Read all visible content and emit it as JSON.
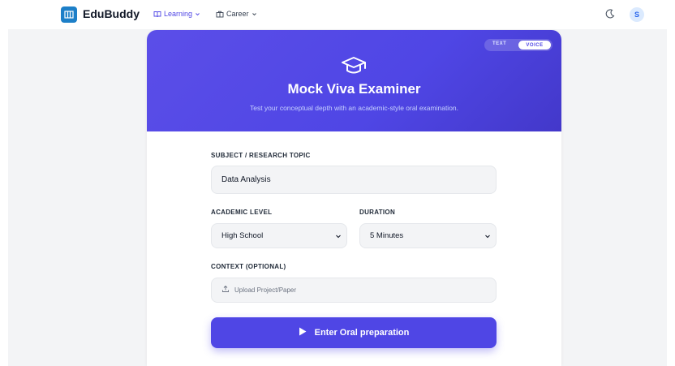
{
  "nav": {
    "brand": "EduBuddy",
    "learning": "Learning",
    "career": "Career",
    "avatar_initial": "S"
  },
  "hero": {
    "toggle_text": "TEXT",
    "toggle_voice": "VOICE",
    "title": "Mock Viva Examiner",
    "subtitle": "Test your conceptual depth with an academic-style oral examination."
  },
  "form": {
    "subject_label": "SUBJECT / RESEARCH TOPIC",
    "subject_value": "Data Analysis",
    "level_label": "ACADEMIC LEVEL",
    "level_value": "High School",
    "duration_label": "DURATION",
    "duration_value": "5 Minutes",
    "context_label": "CONTEXT (OPTIONAL)",
    "upload_label": "Upload Project/Paper",
    "submit_label": "Enter Oral preparation"
  },
  "colors": {
    "accent": "#4f46e5",
    "brand": "#1d7fc8"
  },
  "icons": [
    "grid-logo-icon",
    "book-icon",
    "briefcase-icon",
    "moon-icon",
    "graduation-cap-icon",
    "upload-icon",
    "play-icon",
    "chevron-down-icon"
  ]
}
